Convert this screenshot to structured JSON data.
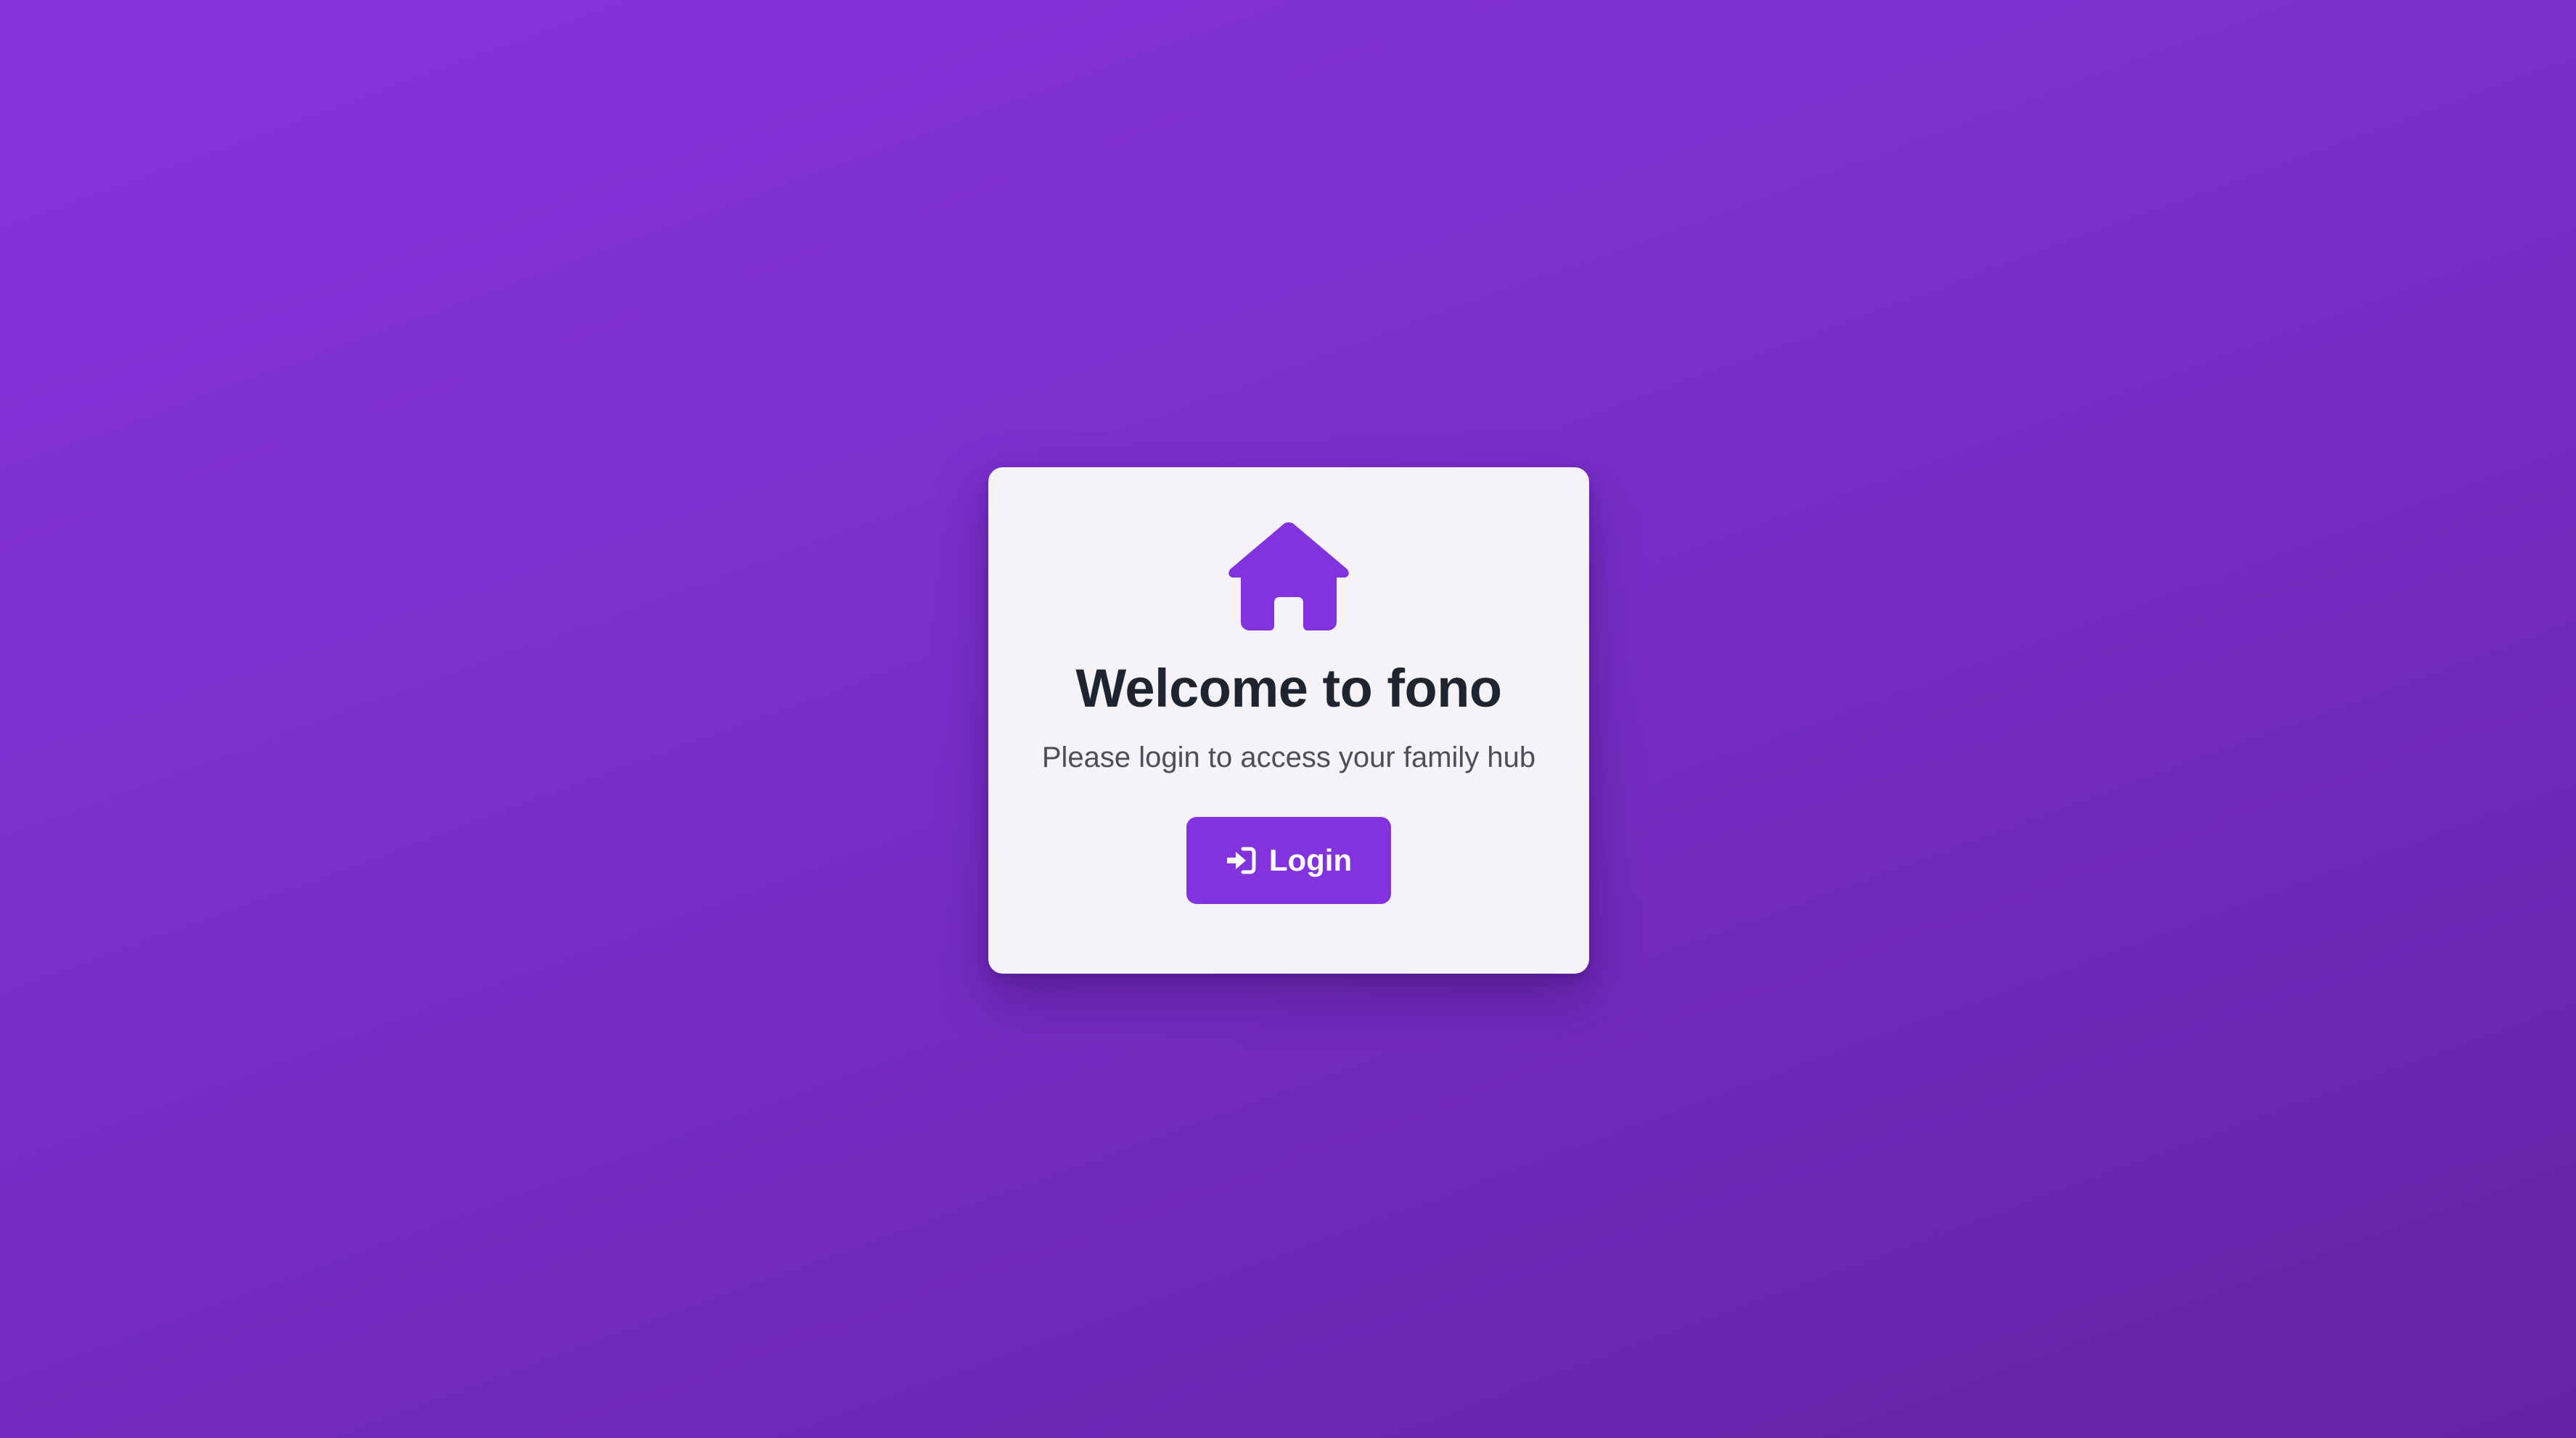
{
  "app": {
    "brand_color": "#8233de"
  },
  "card": {
    "icon": "house-icon",
    "title": "Welcome to fono",
    "subtitle": "Please login to access your family hub",
    "login_button": {
      "icon": "sign-in-icon",
      "label": "Login"
    }
  }
}
